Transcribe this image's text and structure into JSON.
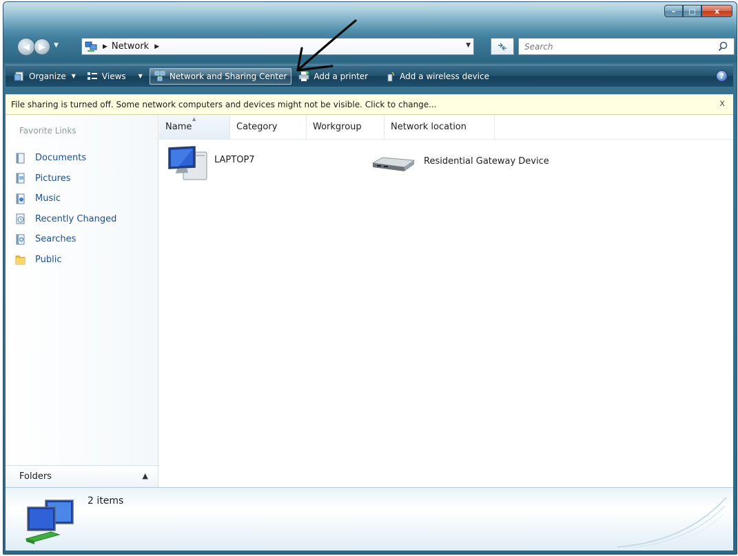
{
  "window": {
    "controls": {
      "minimize": "–",
      "maximize": "□",
      "close": "x"
    }
  },
  "address_bar": {
    "location": "Network",
    "search_placeholder": "Search"
  },
  "command_bar": {
    "organize": "Organize",
    "views": "Views",
    "network_sharing_center": "Network and Sharing Center",
    "add_printer": "Add a printer",
    "add_wireless": "Add a wireless device",
    "help": "?"
  },
  "info_bar": {
    "message": "File sharing is turned off. Some network computers and devices might not be visible. Click to change...",
    "close": "x"
  },
  "nav_pane": {
    "title": "Favorite Links",
    "items": [
      {
        "label": "Documents",
        "icon": "documents-icon"
      },
      {
        "label": "Pictures",
        "icon": "pictures-icon"
      },
      {
        "label": "Music",
        "icon": "music-icon"
      },
      {
        "label": "Recently Changed",
        "icon": "recently-changed-icon"
      },
      {
        "label": "Searches",
        "icon": "searches-icon"
      },
      {
        "label": "Public",
        "icon": "public-folder-icon"
      }
    ],
    "folders_label": "Folders"
  },
  "columns": [
    "Name",
    "Category",
    "Workgroup",
    "Network location"
  ],
  "items": [
    {
      "label": "LAPTOP7",
      "icon": "computer-icon"
    },
    {
      "label": "Residential Gateway Device",
      "icon": "gateway-device-icon"
    }
  ],
  "details": {
    "count": "2 items"
  },
  "colors": {
    "command_bar": "#1e4f6d",
    "info_bar": "#ffffe1",
    "link_text": "#1c4f8c"
  }
}
